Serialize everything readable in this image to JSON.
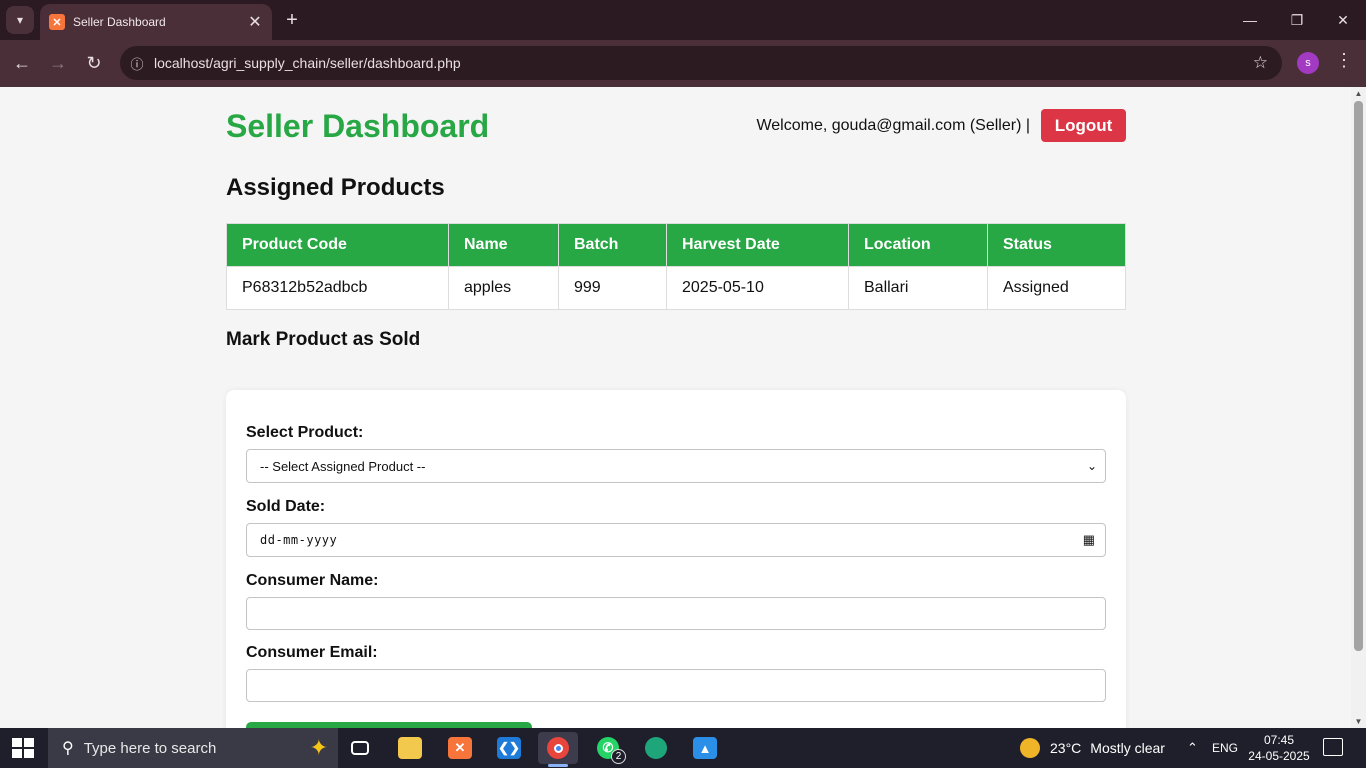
{
  "browser": {
    "tab_title": "Seller Dashboard",
    "url": "localhost/agri_supply_chain/seller/dashboard.php",
    "profile_initial": "s"
  },
  "page": {
    "title": "Seller Dashboard",
    "welcome_text": "Welcome, gouda@gmail.com (Seller) |",
    "logout_label": "Logout",
    "assigned_heading": "Assigned Products",
    "table": {
      "headers": [
        "Product Code",
        "Name",
        "Batch",
        "Harvest Date",
        "Location",
        "Status"
      ],
      "rows": [
        [
          "P68312b52adbcb",
          "apples",
          "999",
          "2025-05-10",
          "Ballari",
          "Assigned"
        ]
      ]
    },
    "form": {
      "heading": "Mark Product as Sold",
      "product_label": "Select Product:",
      "product_selected": "-- Select Assigned Product --",
      "date_label": "Sold Date:",
      "date_placeholder": "dd-mm-yyyy",
      "consumer_name_label": "Consumer Name:",
      "consumer_name_value": "",
      "consumer_email_label": "Consumer Email:",
      "consumer_email_value": ""
    }
  },
  "taskbar": {
    "search_placeholder": "Type here to search",
    "whatsapp_badge": "2",
    "weather": "23°C",
    "weather_desc": "Mostly clear",
    "lang": "ENG",
    "time": "07:45",
    "date": "24-05-2025"
  },
  "colors": {
    "brand_green": "#28a745",
    "logout_red": "#dc3545"
  },
  "icons": [
    "tab-list-icon",
    "xampp-icon",
    "close-icon",
    "plus-icon",
    "minimize-icon",
    "restore-icon",
    "back-icon",
    "forward-icon",
    "reload-icon",
    "site-info-icon",
    "star-icon",
    "more-icon",
    "chevron-down-icon",
    "calendar-icon",
    "windows-icon",
    "search-icon",
    "copilot-icon",
    "task-view-icon",
    "file-explorer-icon",
    "vscode-icon",
    "chrome-icon",
    "whatsapp-icon",
    "edge-icon",
    "photos-icon",
    "weather-icon",
    "chevron-up-icon",
    "notification-icon"
  ]
}
